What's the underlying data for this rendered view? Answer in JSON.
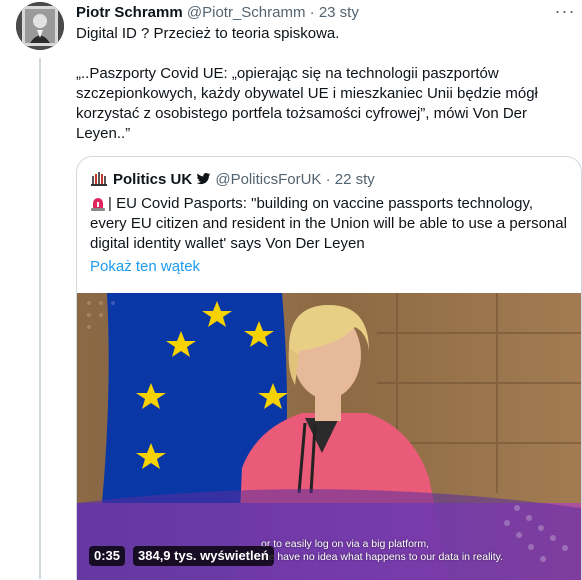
{
  "tweet": {
    "author_name": "Piotr Schramm",
    "author_handle": "@Piotr_Schramm",
    "separator": "·",
    "date": "23 sty",
    "line1": "Digital ID ? Przecież to teoria spiskowa.",
    "line2": "„..Paszporty Covid UE: „opierając się na technologii paszportów szczepionkowych, każdy obywatel UE i mieszkaniec Unii będzie mógł korzystać z osobistego portfela tożsamości cyfrowej”, mówi Von Der Leyen..”",
    "more_icon": "more-icon"
  },
  "quote": {
    "author_name": "Politics UK",
    "author_handle": "@PoliticsForUK",
    "separator": "·",
    "date": "22 sty",
    "text": "| EU Covid Pasports: \"building on vaccine passports technology, every EU citizen and resident in the Union will be able to use a personal digital identity wallet' says Von Der Leyen",
    "show_thread": "Pokaż ten wątek",
    "link_color": "#1d9bf0"
  },
  "video": {
    "time": "0:35",
    "views": "384,9 tys. wyświetleń",
    "caption_line1": "or to easily log on via a big platform,",
    "caption_line2": "we have no idea what happens  to our data in reality."
  }
}
